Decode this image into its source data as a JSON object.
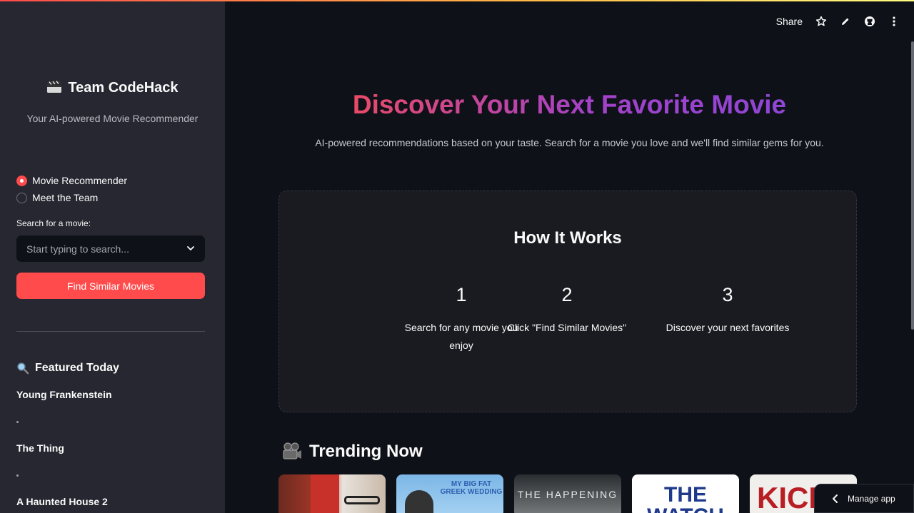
{
  "sidebar": {
    "brand": "Team CodeHack",
    "subtitle": "Your AI-powered Movie Recommender",
    "nav": [
      {
        "label": "Movie Recommender",
        "selected": true
      },
      {
        "label": "Meet the Team",
        "selected": false
      }
    ],
    "search": {
      "label": "Search for a movie:",
      "placeholder": "Start typing to search..."
    },
    "find_button": "Find Similar Movies",
    "featured": {
      "title": "Featured Today",
      "items": [
        "Young Frankenstein",
        "The Thing",
        "A Haunted House 2"
      ]
    }
  },
  "toolbar": {
    "share": "Share",
    "icons": [
      "star-icon",
      "pencil-icon",
      "github-icon",
      "kebab-menu-icon"
    ]
  },
  "main": {
    "title": "Discover Your Next Favorite Movie",
    "lead": "AI-powered recommendations based on your taste. Search for a movie you love and we'll find similar gems for you.",
    "how": {
      "title": "How It Works",
      "steps": [
        {
          "num": "1",
          "text": "Search for any movie you enjoy"
        },
        {
          "num": "2",
          "text": "Click \"Find Similar Movies\""
        },
        {
          "num": "3",
          "text": "Discover your next favorites"
        }
      ]
    },
    "trending": {
      "title": "Trending Now",
      "posters": [
        {
          "text": ""
        },
        {
          "text": "MY BIG FAT GREEK WEDDING"
        },
        {
          "text": "THE HAPPENING"
        },
        {
          "text": "THE WATCH"
        },
        {
          "text": "KICK"
        }
      ]
    }
  },
  "manage_app": "Manage app",
  "colors": {
    "accent": "#ff4b4b",
    "sidebar_bg": "#262730",
    "main_bg": "#0e1117",
    "title_gradient_start": "#e94a68",
    "title_gradient_end": "#8e46d6"
  }
}
